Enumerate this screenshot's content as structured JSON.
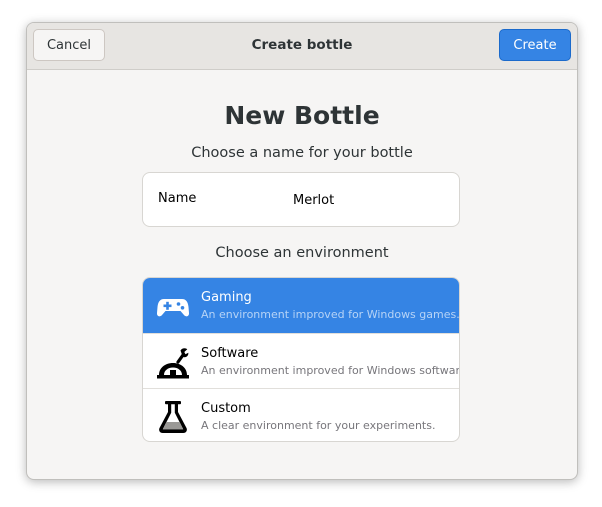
{
  "window": {
    "title": "Create bottle"
  },
  "header": {
    "cancel_label": "Cancel",
    "create_label": "Create"
  },
  "main": {
    "title": "New Bottle",
    "name_prompt": "Choose a name for your bottle",
    "name_label": "Name",
    "name_value": "Merlot",
    "env_prompt": "Choose an environment"
  },
  "environments": [
    {
      "title": "Gaming",
      "description": "An environment improved for Windows games.",
      "icon": "gamepad-icon",
      "selected": true
    },
    {
      "title": "Software",
      "description": "An environment improved for Windows software.",
      "icon": "software-tools-icon",
      "selected": false
    },
    {
      "title": "Custom",
      "description": "A clear environment for your experiments.",
      "icon": "flask-icon",
      "selected": false
    }
  ],
  "colors": {
    "accent": "#3584e4",
    "window_bg": "#f6f5f4",
    "header_bg": "#e7e5e2"
  }
}
